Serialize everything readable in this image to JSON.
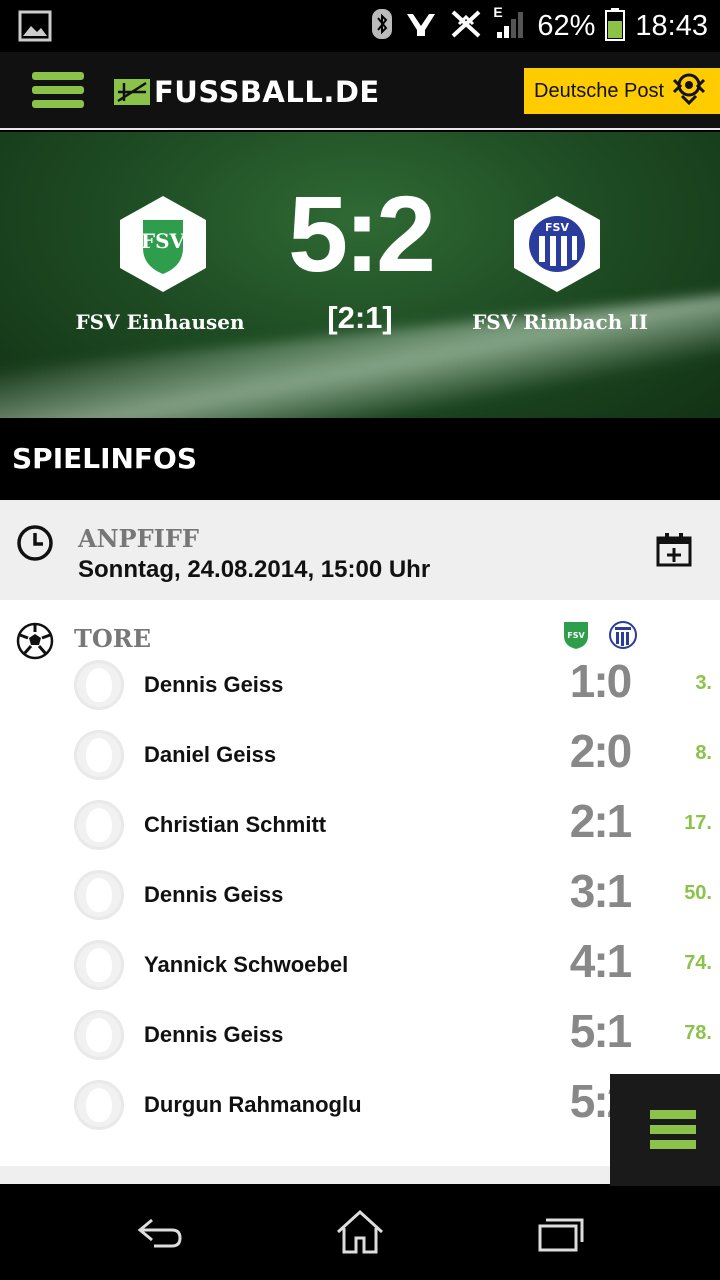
{
  "status_bar": {
    "network": "E",
    "battery": "62%",
    "time": "18:43"
  },
  "header": {
    "brand": "FUSSBALL.DE",
    "sponsor": "Deutsche Post"
  },
  "match": {
    "home_team": "FSV Einhausen",
    "away_team": "FSV Rimbach II",
    "score": "5:2",
    "halftime": "[2:1]"
  },
  "section": {
    "title": "SPIELINFOS"
  },
  "kickoff": {
    "label": "ANPFIFF",
    "value": "Sonntag, 24.08.2014, 15:00 Uhr"
  },
  "goals": {
    "label": "TORE",
    "items": [
      {
        "player": "Dennis Geiss",
        "score": "1:0",
        "minute": "3."
      },
      {
        "player": "Daniel Geiss",
        "score": "2:0",
        "minute": "8."
      },
      {
        "player": "Christian Schmitt",
        "score": "2:1",
        "minute": "17."
      },
      {
        "player": "Dennis Geiss",
        "score": "3:1",
        "minute": "50."
      },
      {
        "player": "Yannick Schwoebel",
        "score": "4:1",
        "minute": "74."
      },
      {
        "player": "Dennis Geiss",
        "score": "5:1",
        "minute": "78."
      },
      {
        "player": "Durgun Rahmanoglu",
        "score": "5:2",
        "minute": ""
      }
    ]
  },
  "colors": {
    "accent": "#8bc34a",
    "sponsor": "#ffcc00"
  }
}
